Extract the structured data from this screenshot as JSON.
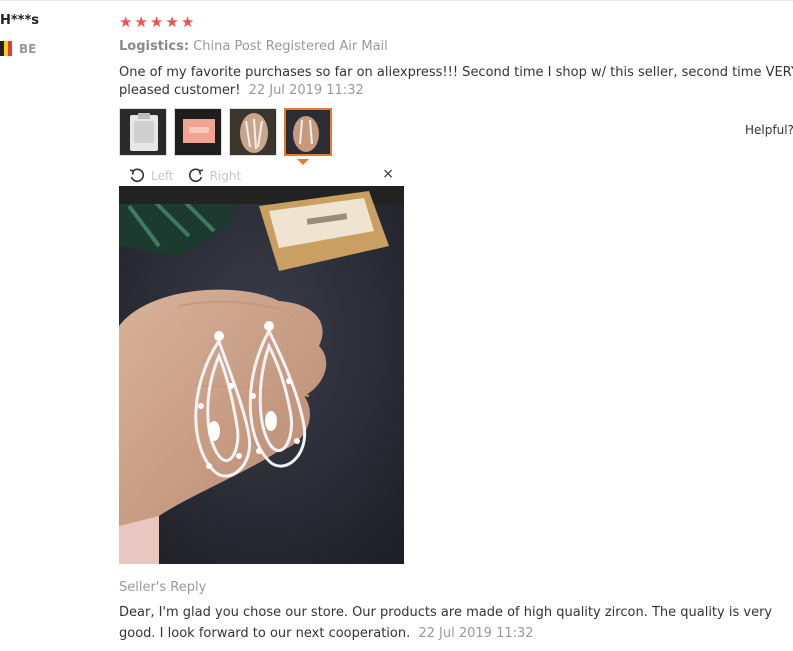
{
  "reviewer": {
    "name": "H***s",
    "country_code": "BE",
    "flag_colors": [
      "#222222",
      "#f6d21a",
      "#e23b3b"
    ]
  },
  "rating": {
    "stars": 5,
    "star_color": "#f0534d",
    "star_icon": "star-icon"
  },
  "logistics": {
    "label": "Logistics:",
    "value": "China Post Registered Air Mail"
  },
  "review": {
    "text": "One of my favorite purchases so far on aliexpress!!! Second time I shop w/ this seller, second time VERY pleased customer!",
    "date": "22 Jul 2019 11:32"
  },
  "thumbnails": [
    {
      "name": "photo-thumb-1",
      "active": false
    },
    {
      "name": "photo-thumb-2",
      "active": false
    },
    {
      "name": "photo-thumb-3",
      "active": false
    },
    {
      "name": "photo-thumb-4",
      "active": true
    }
  ],
  "helpful_label": "Helpful?",
  "viewer": {
    "rotate_left_label": "Left",
    "rotate_right_label": "Right",
    "close_symbol": "×",
    "accent": "#e8782b"
  },
  "seller_reply": {
    "title": "Seller's Reply",
    "text": "Dear, I'm glad you chose our store. Our products are made of high quality zircon. The quality is very good. I look forward to our next cooperation.",
    "date": "22 Jul 2019 11:32"
  }
}
